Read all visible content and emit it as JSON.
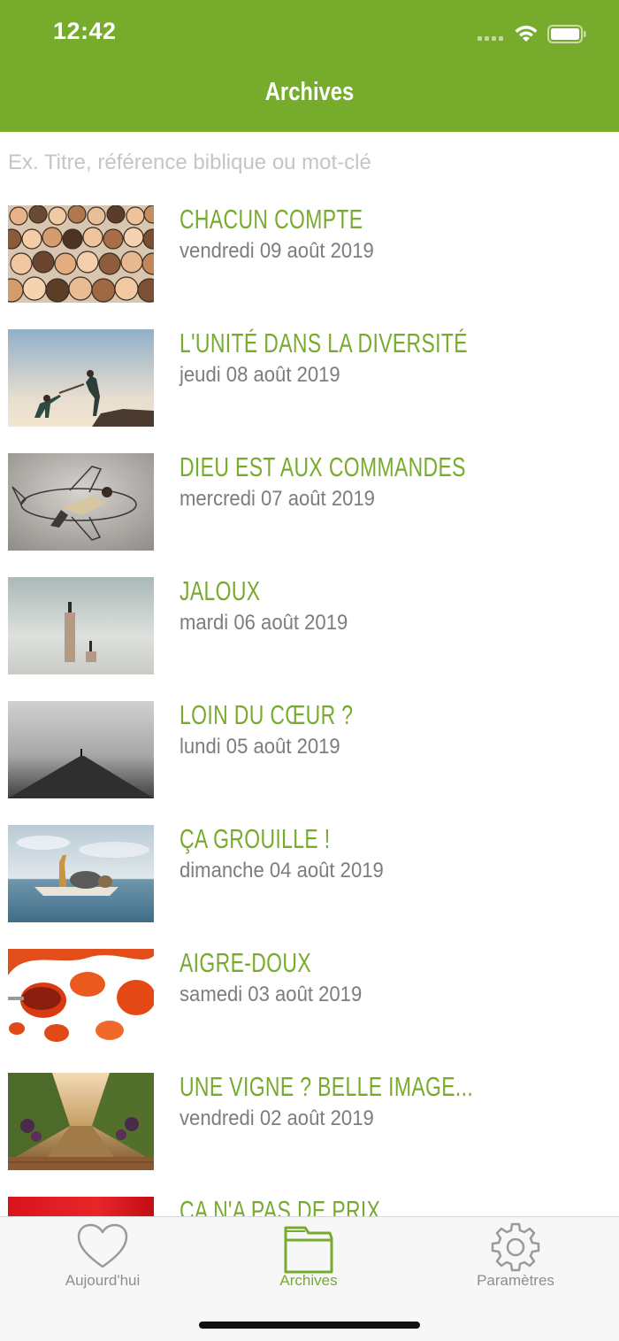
{
  "status_bar": {
    "time": "12:42"
  },
  "nav": {
    "title": "Archives"
  },
  "search": {
    "placeholder": "Ex. Titre, référence biblique ou mot-clé"
  },
  "items": [
    {
      "title": "CHACUN COMPTE",
      "date": "vendredi 09 août 2019",
      "image": "crowd-faces"
    },
    {
      "title": "L'UNITÉ DANS LA DIVERSITÉ",
      "date": "jeudi 08 août 2019",
      "image": "helping-hand-climb"
    },
    {
      "title": "DIEU EST AUX COMMANDES",
      "date": "mercredi 07 août 2019",
      "image": "man-drawn-airplane"
    },
    {
      "title": "JALOUX",
      "date": "mardi 06 août 2019",
      "image": "pillars-fog"
    },
    {
      "title": "LOIN DU CŒUR ?",
      "date": "lundi 05 août 2019",
      "image": "pier-fog"
    },
    {
      "title": "ÇA GROUILLE !",
      "date": "dimanche 04 août 2019",
      "image": "animals-boat"
    },
    {
      "title": "AIGRE-DOUX",
      "date": "samedi 03 août 2019",
      "image": "sauce-spoon"
    },
    {
      "title": "UNE VIGNE ? BELLE IMAGE...",
      "date": "vendredi 02 août 2019",
      "image": "vineyard"
    },
    {
      "title": "ÇA N'A PAS DE PRIX",
      "date": "",
      "image": "red-gradient"
    }
  ],
  "tabs": [
    {
      "label": "Aujourd'hui",
      "icon": "heart-icon",
      "active": false
    },
    {
      "label": "Archives",
      "icon": "archive-box-icon",
      "active": true
    },
    {
      "label": "Paramètres",
      "icon": "gear-icon",
      "active": false
    }
  ],
  "colors": {
    "accent": "#77ab2c",
    "date_text": "#7d7d7d",
    "placeholder": "#c4c4c9"
  }
}
